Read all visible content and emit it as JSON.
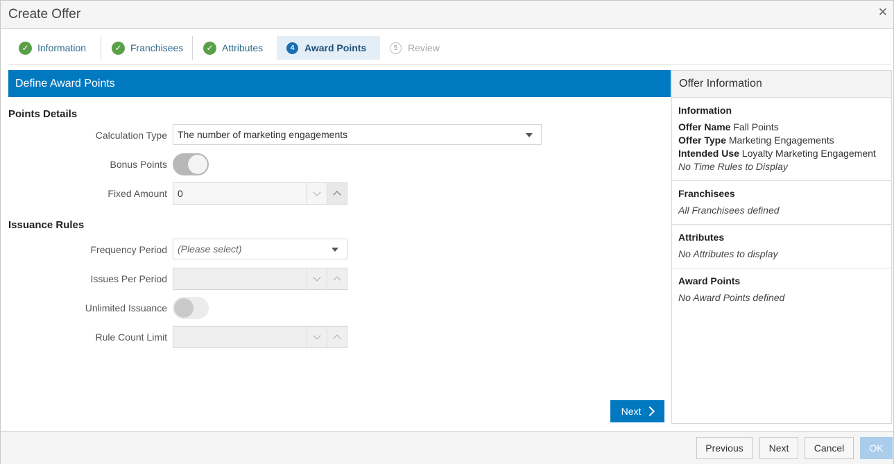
{
  "dialog": {
    "title": "Create Offer"
  },
  "train": {
    "steps": [
      {
        "label": "Information",
        "state": "done"
      },
      {
        "label": "Franchisees",
        "state": "done"
      },
      {
        "label": "Attributes",
        "state": "done"
      },
      {
        "label": "Award Points",
        "state": "active",
        "number": "4"
      },
      {
        "label": "Review",
        "state": "disabled",
        "number": "5"
      }
    ]
  },
  "main": {
    "header": "Define Award Points",
    "points_details": {
      "title": "Points Details",
      "calculation_type_label": "Calculation Type",
      "calculation_type_value": "The number of marketing engagements",
      "bonus_points_label": "Bonus Points",
      "fixed_amount_label": "Fixed Amount",
      "fixed_amount_value": "0"
    },
    "issuance_rules": {
      "title": "Issuance Rules",
      "frequency_period_label": "Frequency Period",
      "frequency_period_placeholder": "(Please select)",
      "issues_per_period_label": "Issues Per Period",
      "unlimited_issuance_label": "Unlimited Issuance",
      "rule_count_limit_label": "Rule Count Limit"
    },
    "next_label": "Next"
  },
  "side": {
    "header": "Offer Information",
    "information": {
      "title": "Information",
      "offer_name_label": "Offer Name",
      "offer_name_value": "Fall Points",
      "offer_type_label": "Offer Type",
      "offer_type_value": "Marketing Engagements",
      "intended_use_label": "Intended Use",
      "intended_use_value": "Loyalty Marketing Engagement",
      "time_rules": "No Time Rules to Display"
    },
    "franchisees": {
      "title": "Franchisees",
      "text": "All Franchisees defined"
    },
    "attributes": {
      "title": "Attributes",
      "text": "No Attributes to display"
    },
    "award_points": {
      "title": "Award Points",
      "text": "No Award Points defined"
    }
  },
  "footer": {
    "previous": "Previous",
    "next": "Next",
    "cancel": "Cancel",
    "ok": "OK"
  }
}
